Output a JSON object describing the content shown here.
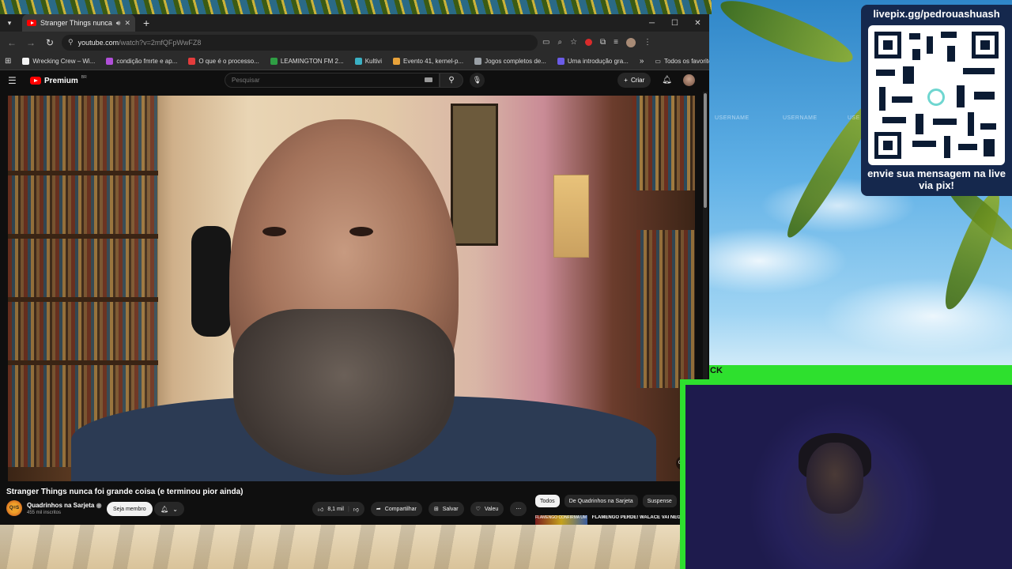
{
  "browser": {
    "tab_title": "Stranger Things nunca foi g",
    "url_host": "youtube.com",
    "url_path": "/watch?v=2mfQFpWwFZ8",
    "bookmarks": [
      {
        "label": "Wrecking Crew – Wi...",
        "color": "#f4f4f4"
      },
      {
        "label": "condição fmrte e ap...",
        "color": "#b04fd8"
      },
      {
        "label": "O que é o processo...",
        "color": "#e43c3c"
      },
      {
        "label": "LEAMINGTON FM 2...",
        "color": "#2f9e44"
      },
      {
        "label": "Kultivi",
        "color": "#3ab0c4"
      },
      {
        "label": "Evento 41, kernel-p...",
        "color": "#e8a23a"
      },
      {
        "label": "Jogos completos de...",
        "color": "#9aa0a6"
      },
      {
        "label": "Uma introdução gra...",
        "color": "#6b5ce7"
      }
    ],
    "all_bookmarks": "Todos os favoritos"
  },
  "youtube": {
    "logo_text": "Premium",
    "logo_sup": "BR",
    "search_placeholder": "Pesquisar",
    "create_label": "Criar",
    "video_title": "Stranger Things nunca foi grande coisa (e terminou pior ainda)",
    "channel_name": "Quadrinhos na Sarjeta",
    "channel_subs": "455 mil inscritos",
    "channel_avatar_text": "Q=S",
    "join_label": "Seja membro",
    "likes": "8,1 mil",
    "share_label": "Compartilhar",
    "save_label": "Salvar",
    "thanks_label": "Valeu",
    "chips": [
      "Todos",
      "De Quadrinhos na Sarjeta",
      "Suspense"
    ],
    "rec_thumb_text": "FLAMENGO CONFIRMA UM DOS MAIORES",
    "rec_title": "FLAMENGO PERDE! WALACE VAI NEGOCIAR COM A CAMA"
  },
  "overlay": {
    "qr_url": "livepix.gg/pedrouashuash",
    "qr_message": "envie sua mensagem na live via pix!",
    "ghost_labels": [
      "USERNAME",
      "USERNAME",
      "USE"
    ],
    "cam_tag": "CK"
  },
  "colors": {
    "accent_green": "#2ee02e",
    "youtube_red": "#ff0000",
    "qr_panel": "#15284d"
  }
}
